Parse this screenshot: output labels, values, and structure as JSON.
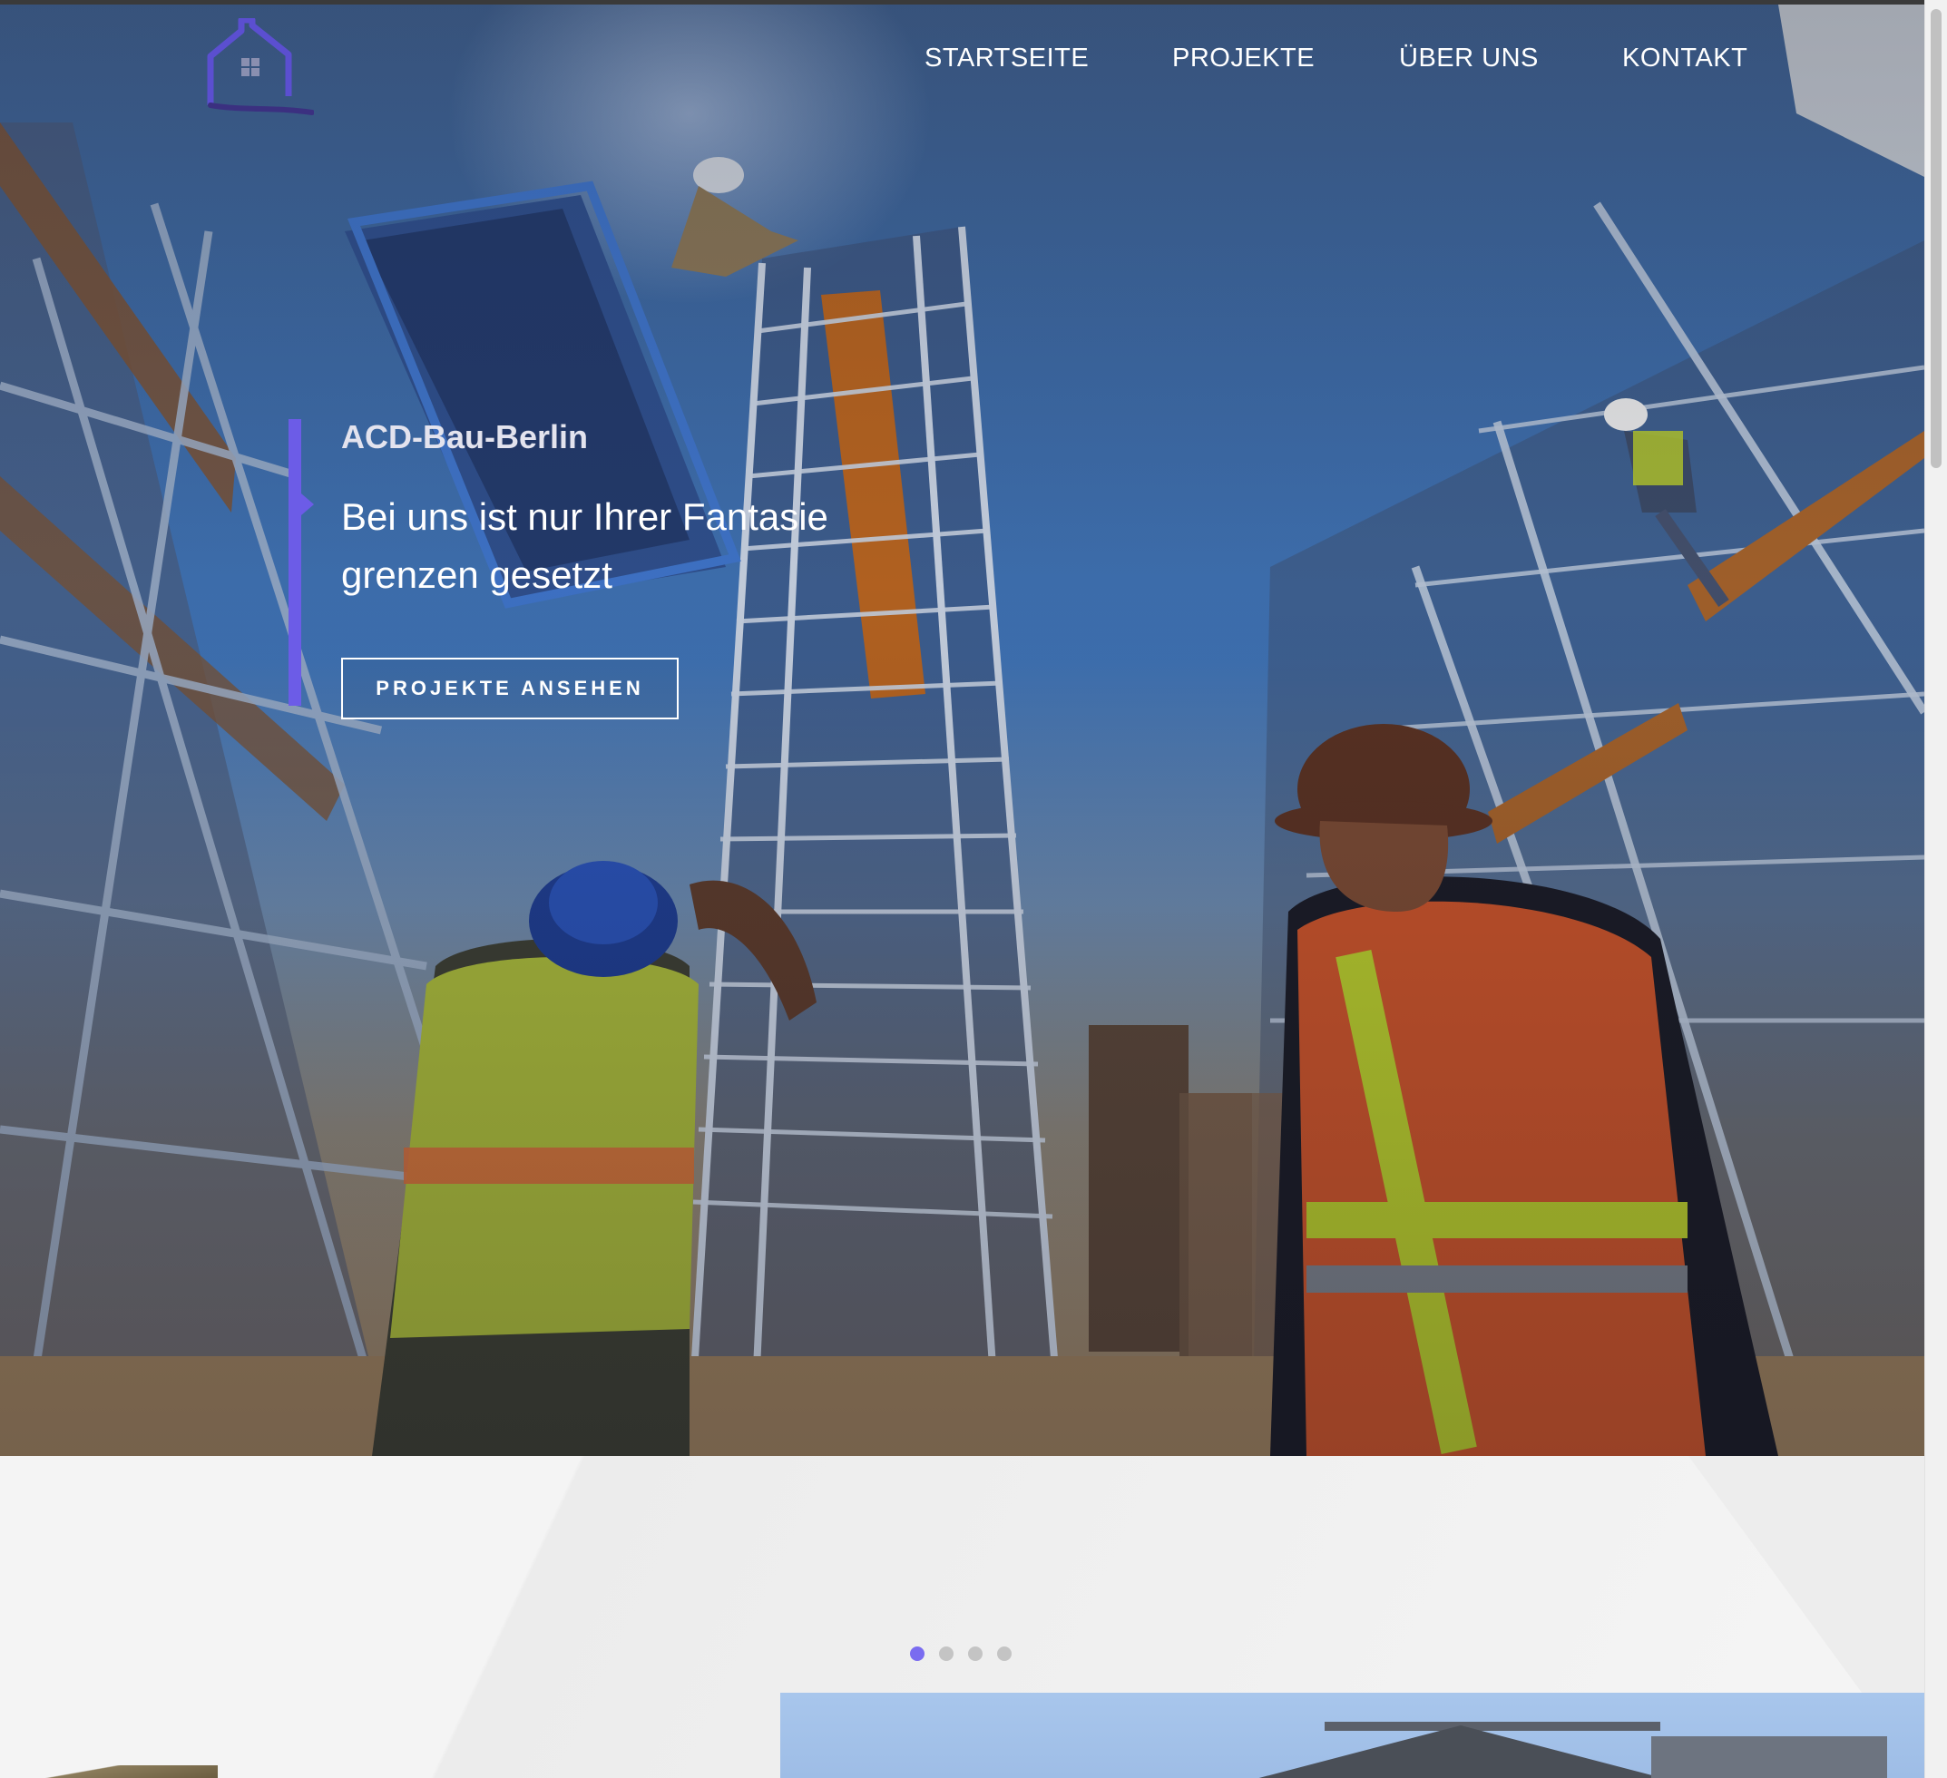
{
  "nav": {
    "items": [
      {
        "label": "STARTSEITE"
      },
      {
        "label": "PROJEKTE"
      },
      {
        "label": "ÜBER UNS"
      },
      {
        "label": "KONTAKT"
      }
    ]
  },
  "logo": {
    "icon": "house-logo-icon"
  },
  "hero": {
    "brand": "ACD-Bau-Berlin",
    "headline": "Bei uns ist nur Ihrer Fantasie grenzen gesetzt",
    "cta_label": "PROJEKTE ANSEHEN",
    "background": "construction workers on scaffolding photo"
  },
  "slider": {
    "dot_count": 4,
    "active_index": 0
  },
  "colors": {
    "accent": "#6c5ce7",
    "dot_active": "#7a6cf0",
    "dot_inactive": "#c4c4c4",
    "section_bg": "#f4f4f4"
  }
}
